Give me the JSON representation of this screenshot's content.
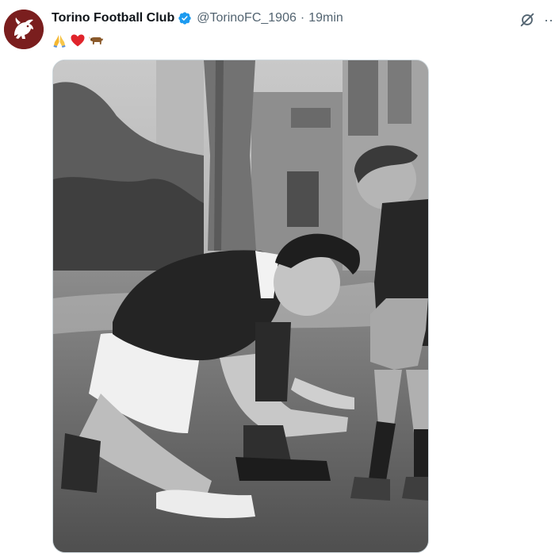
{
  "tweet": {
    "display_name": "Torino Football Club",
    "handle": "@TorinoFC_1906",
    "separator": "·",
    "time": "19min",
    "body_emojis": [
      "pray-emoji",
      "red-heart-emoji",
      "ox-emoji"
    ],
    "more_label": "···"
  },
  "colors": {
    "club_maroon": "#7a1e1e",
    "verified_blue": "#1d9bf0",
    "secondary_text": "#536471"
  },
  "icons": {
    "avatar": "torino-bull-logo",
    "verified": "verified-badge-icon",
    "grok": "grok-icon",
    "more": "more-icon"
  }
}
